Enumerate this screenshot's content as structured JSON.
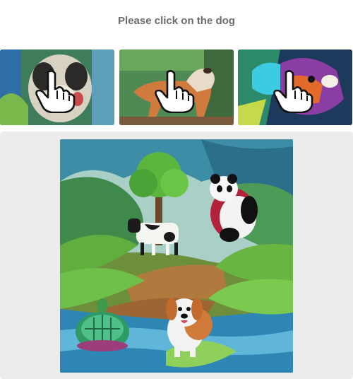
{
  "instruction": "Please click on the dog",
  "examples": [
    {
      "icon": "pointer-hand-icon",
      "subject": "pug-dog"
    },
    {
      "icon": "pointer-hand-icon",
      "subject": "brown-dog"
    },
    {
      "icon": "pointer-hand-icon",
      "subject": "colorful-dog"
    }
  ],
  "scene_objects": [
    "tree",
    "panda",
    "cow",
    "turtle",
    "dog"
  ]
}
